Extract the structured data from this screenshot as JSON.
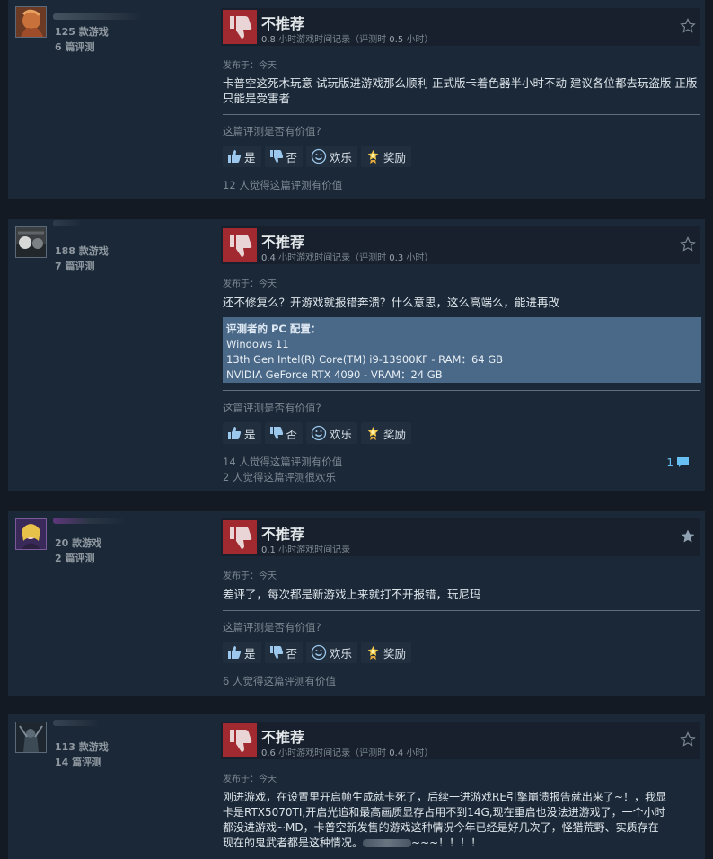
{
  "labels": {
    "verdict": "不推荐",
    "hours_unit": "小时游戏时间记录",
    "at_review_open": "（评测时",
    "at_review_close": "小时）",
    "posted_prefix": "发布于：",
    "helpful_question": "这篇评测是否有价值?",
    "btn_yes": "是",
    "btn_no": "否",
    "btn_funny": "欢乐",
    "btn_award": "奖励"
  },
  "colors": {
    "thumb_bg": "#a02a30",
    "link": "#66c0f4",
    "spec_bg": "#4a6887"
  },
  "reviews": [
    {
      "games": "125 款游戏",
      "reviews": "6 篇评测",
      "hours_total": "0.8",
      "hours_at_review": "0.5",
      "posted": "今天",
      "text": "卡普空这死木玩意 试玩版进游戏那么顺利 正式版卡着色器半小时不动 建议各位都去玩盗版 正版只能是受害者",
      "helpful": "12 人觉得这篇评测有价值",
      "award_icon": "star-outline-icon"
    },
    {
      "games": "188 款游戏",
      "reviews": "7 篇评测",
      "hours_total": "0.4",
      "hours_at_review": "0.3",
      "posted": "今天",
      "text": "还不修复么？开游戏就报错奔溃？什么意思，这么高端么，能进再改",
      "spec": {
        "title": "评测者的 PC 配置：",
        "os": "Windows 11",
        "cpu": "13th Gen Intel(R) Core(TM) i9-13900KF - RAM：64 GB",
        "gpu": "NVIDIA GeForce RTX 4090 - VRAM：24 GB"
      },
      "helpful": "14 人觉得这篇评测有价值",
      "funny": "2 人觉得这篇评测很欢乐",
      "comments": "1",
      "award_icon": "star-outline-icon"
    },
    {
      "games": "20 款游戏",
      "reviews": "2 篇评测",
      "hours_total": "0.1",
      "posted": "今天",
      "text": "差评了，每次都是新游戏上来就打不开报错，玩尼玛",
      "helpful": "6 人觉得这篇评测有价值",
      "award_icon": "star-filled-icon"
    },
    {
      "games": "113 款游戏",
      "reviews": "14 篇评测",
      "hours_total": "0.6",
      "hours_at_review": "0.4",
      "posted": "今天",
      "text_lines": [
        "刚进游戏，在设置里开启帧生成就卡死了，后续一进游戏RE引擎崩溃报告就出来了~！，我显",
        "卡是RTX5070TI,开启光追和最高画质显存占用不到14G,现在重启也没法进游戏了，一个小时",
        "都没进游戏~MD，卡普空新发售的游戏这种情况今年已经是好几次了，怪猎荒野、实质存在",
        "现在的鬼武者都是这种情况。"
      ],
      "text_tail": "~~~！！！！",
      "award_icon": "star-outline-icon"
    }
  ]
}
